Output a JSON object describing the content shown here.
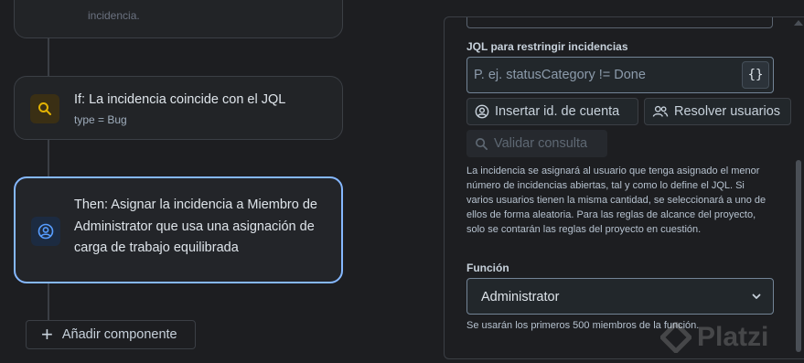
{
  "flow": {
    "top_card": {
      "text": "incidencia."
    },
    "if_card": {
      "title": "If: La incidencia coincide con el JQL",
      "subtitle": "type = Bug",
      "icon": "search-icon",
      "icon_color": "#e2b203"
    },
    "then_card": {
      "title": "Then: Asignar la incidencia a Miembro de Administrator que usa una asignación de carga de trabajo equilibrada",
      "icon": "user-circle-icon",
      "icon_color": "#579dff",
      "border_color": "#85b8ff"
    },
    "add_component_label": "Añadir componente"
  },
  "panel": {
    "jql_label": "JQL para restringir incidencias",
    "jql_placeholder": "P. ej. statusCategory != Done",
    "jql_button_label": "{}",
    "insert_account_label": "Insertar id. de cuenta",
    "resolve_users_label": "Resolver usuarios",
    "validate_label": "Validar consulta",
    "description": "La incidencia se asignará al usuario que tenga asignado el menor número de incidencias abiertas, tal y como lo define el JQL. Si varios usuarios tienen la misma cantidad, se seleccionará a uno de ellos de forma aleatoria. Para las reglas de alcance del proyecto, solo se contarán las reglas del proyecto en cuestión.",
    "function_label": "Función",
    "function_value": "Administrator",
    "function_helper": "Se usarán los primeros 500 miembros de la función."
  },
  "watermark": {
    "text": "Platzi"
  }
}
